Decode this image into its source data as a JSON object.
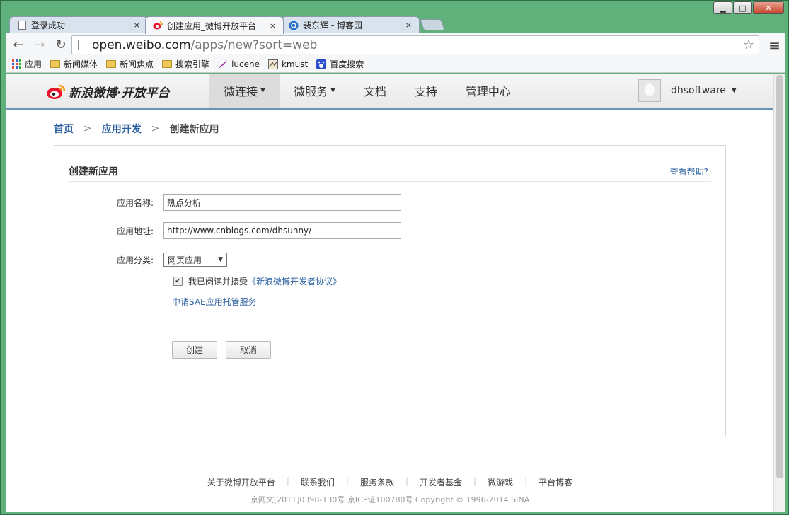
{
  "window": {
    "minimize": "▁",
    "maximize": "□",
    "close": "✕"
  },
  "tabs": [
    {
      "title": "登录成功",
      "close": "×",
      "icon": "page-icon"
    },
    {
      "title": "创建应用_微博开放平台",
      "close": "×",
      "icon": "weibo-icon"
    },
    {
      "title": "裴东辉 - 博客园",
      "close": "×",
      "icon": "cnblogs-icon"
    }
  ],
  "toolbar": {
    "url_host": "open.weibo.com",
    "url_path": "/apps/new?sort=web"
  },
  "bookmarks": [
    {
      "label": "应用",
      "icon": "apps-icon"
    },
    {
      "label": "新闻媒体",
      "icon": "folder-icon"
    },
    {
      "label": "新闻焦点",
      "icon": "folder-icon"
    },
    {
      "label": "搜索引擎",
      "icon": "folder-icon"
    },
    {
      "label": "lucene",
      "icon": "feather-icon"
    },
    {
      "label": "kmust",
      "icon": "kmust-icon"
    },
    {
      "label": "百度搜索",
      "icon": "baidu-icon"
    }
  ],
  "site": {
    "logo": "新浪微博·开放平台",
    "nav": [
      {
        "label": "微连接",
        "dropdown": true,
        "active": true
      },
      {
        "label": "微服务",
        "dropdown": true,
        "active": false
      },
      {
        "label": "文档",
        "dropdown": false,
        "active": false
      },
      {
        "label": "支持",
        "dropdown": false,
        "active": false
      },
      {
        "label": "管理中心",
        "dropdown": false,
        "active": false
      }
    ],
    "username": "dhsoftware"
  },
  "breadcrumb": {
    "home": "首页",
    "section": "应用开发",
    "current": "创建新应用",
    "sep": ">"
  },
  "form": {
    "title": "创建新应用",
    "help": "查看帮助?",
    "name_label": "应用名称:",
    "name_value": "热点分析",
    "url_label": "应用地址:",
    "url_value": "http://www.cnblogs.com/dhsunny/",
    "category_label": "应用分类:",
    "category_value": "网页应用",
    "agree_text": "我已阅读并接受",
    "agree_link": "《新浪微博开发者协议》",
    "agree_checked": true,
    "sae_link": "申请SAE应用托管服务",
    "create_button": "创建",
    "cancel_button": "取消"
  },
  "footer": {
    "links": [
      "关于微博开放平台",
      "联系我们",
      "服务条款",
      "开发者基金",
      "微游戏",
      "平台博客"
    ],
    "copyright": "京网文[2011]0398-130号 京ICP证100780号 Copyright © 1996-2014 SINA"
  },
  "colors": {
    "link": "#2a5f9e",
    "header_border": "#6a93b8",
    "window_frame": "#5fb07a"
  }
}
